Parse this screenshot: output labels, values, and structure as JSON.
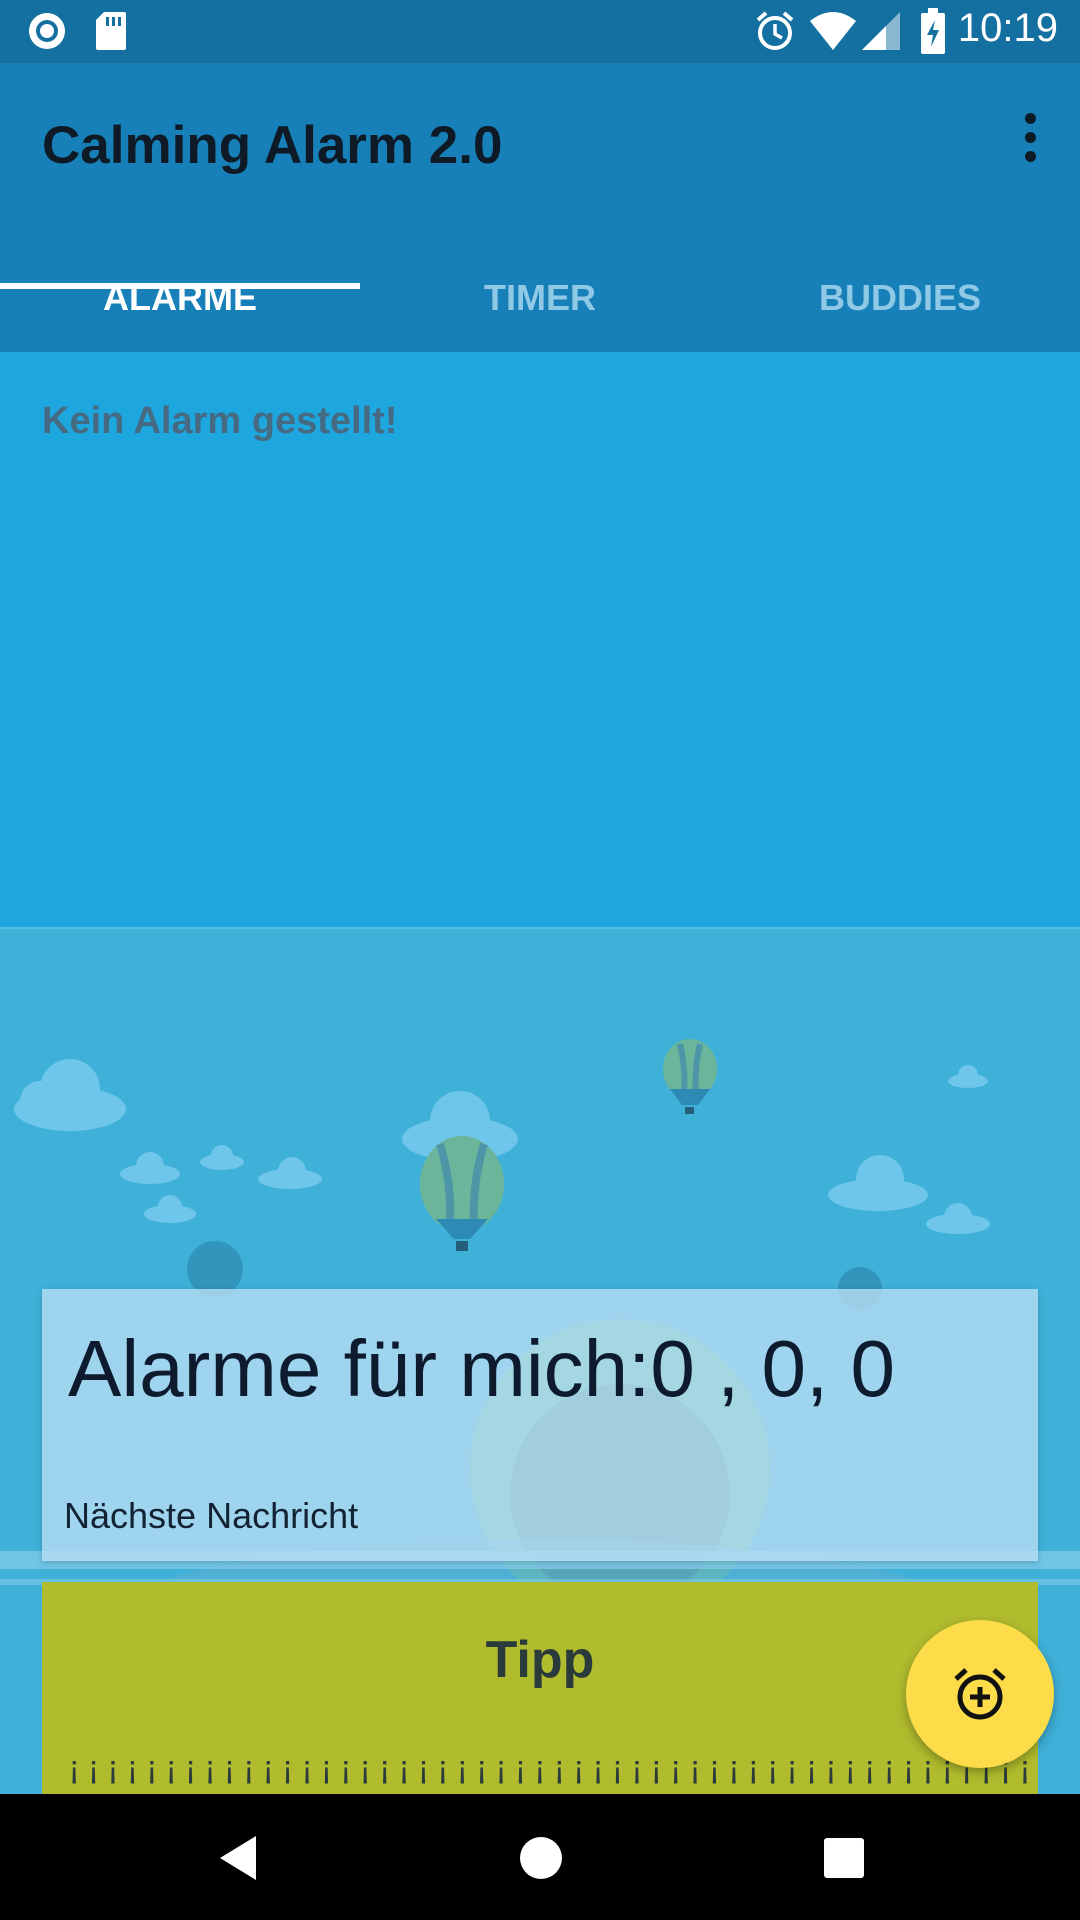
{
  "status_bar": {
    "time": "10:19",
    "icons": [
      "record-icon",
      "sd-card-icon",
      "alarm-clock-icon",
      "wifi-icon",
      "signal-icon",
      "battery-charging-icon"
    ]
  },
  "app_bar": {
    "title": "Calming Alarm 2.0",
    "menu_icon": "more-vert-icon"
  },
  "tabs": [
    {
      "label": "ALARME",
      "active": true
    },
    {
      "label": "TIMER",
      "active": false
    },
    {
      "label": "BUDDIES",
      "active": false
    }
  ],
  "alarms_panel": {
    "empty_text": "Kein Alarm gestellt!"
  },
  "alarm_card": {
    "count_text": "Alarme für mich:0 , 0, 0",
    "next_message_label": "Nächste Nachricht"
  },
  "tip_card": {
    "title": "Tipp",
    "text": "¡¡¡¡¡¡¡¡¡¡¡¡¡¡¡¡¡¡¡¡¡¡¡¡¡¡¡¡¡¡¡¡¡¡¡¡¡¡¡¡¡¡¡¡¡¡¡¡¡¡¡¡¡¡¡¡¡¡¡¡¡¡¡¡¡¡¡¡¡¡¡¡¡¡"
  },
  "fab": {
    "icon": "add-alarm-icon"
  },
  "nav_bar": {
    "icons": [
      "back-icon",
      "home-icon",
      "recents-icon"
    ]
  },
  "colors": {
    "status_bar": "#1470a0",
    "app_bar": "#1880b8",
    "content": "#1ea6de",
    "fab": "#fcdc49",
    "tip_card": "#b0bb2d"
  }
}
